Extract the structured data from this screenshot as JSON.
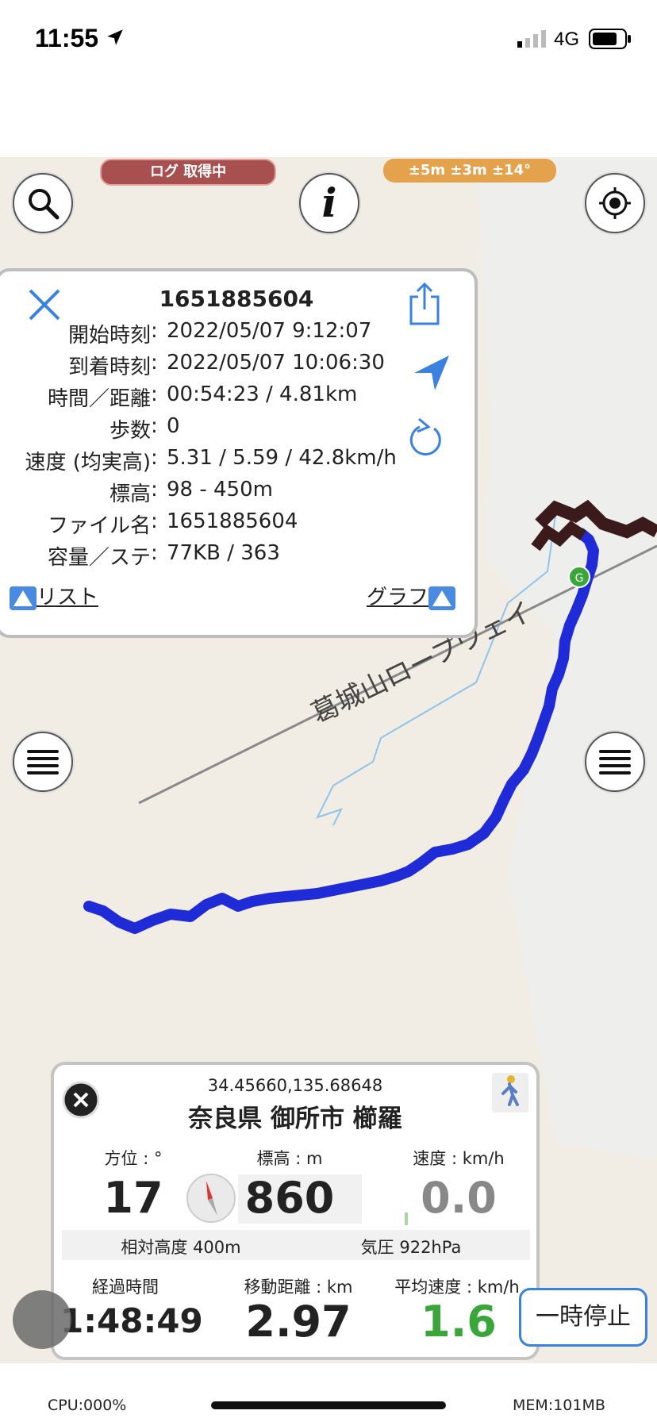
{
  "status_bar": {
    "time": "11:55",
    "network": "4G"
  },
  "badges": {
    "log_status": "ログ 取得中",
    "accuracy": "±5m ±3m ±14°"
  },
  "map": {
    "road_label": "葛城山ロープウェイ",
    "marker_label": "G"
  },
  "log_panel": {
    "title": "1651885604",
    "rows": [
      {
        "label": "開始時刻",
        "sep": ":",
        "value": "2022/05/07 9:12:07"
      },
      {
        "label": "到着時刻",
        "sep": ":",
        "value": "2022/05/07 10:06:30"
      },
      {
        "label": "時間／距離",
        "sep": ":",
        "value": "00:54:23 / 4.81km"
      },
      {
        "label": "歩数",
        "sep": ":",
        "value": "0"
      },
      {
        "label": "速度 (均実高)",
        "sep": ":",
        "value": "5.31 / 5.59 / 42.8km/h"
      },
      {
        "label": "標高",
        "sep": ":",
        "value": "98 - 450m"
      },
      {
        "label": "ファイル名",
        "sep": ":",
        "value": "1651885604"
      },
      {
        "label": "容量／ステ",
        "sep": ":",
        "value": "77KB / 363"
      }
    ],
    "list_link": "リスト",
    "graph_link": "グラフ"
  },
  "info_panel": {
    "coords": "34.45660,135.68648",
    "address": "奈良県 御所市 櫛羅",
    "bearing_label": "方位 : °",
    "bearing_value": "17",
    "elevation_label": "標高 : m",
    "elevation_value": "860",
    "speed_label": "速度 : km/h",
    "speed_value": "0.0",
    "relative_alt": "相対高度 400m",
    "pressure": "気圧 922hPa",
    "elapsed_label": "経過時間",
    "elapsed_value": "1:48:49",
    "distance_label": "移動距離 : km",
    "distance_value": "2.97",
    "avg_speed_label": "平均速度 : km/h",
    "avg_speed_value": "1.6"
  },
  "pause_button": "一時停止",
  "bottom": {
    "cpu": "CPU:000%",
    "mem": "MEM:101MB"
  },
  "colors": {
    "track": "#1f2bd6",
    "log_badge": "#a7504f",
    "accuracy_badge": "#e5a24d",
    "accent_blue": "#3a82e0",
    "avg_speed_green": "#3aa63a"
  }
}
